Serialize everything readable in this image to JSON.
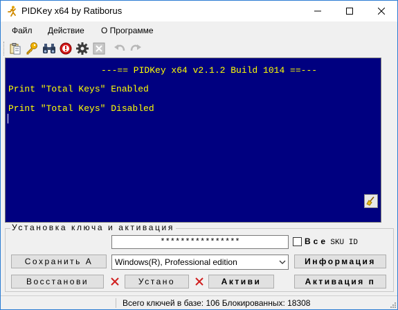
{
  "window": {
    "title": "PIDKey x64 by Ratiborus",
    "app_icon": "runner-icon",
    "controls": [
      "minimize-icon",
      "maximize-icon",
      "close-icon"
    ]
  },
  "menu": {
    "items": [
      {
        "label": "Файл"
      },
      {
        "label": "Действие"
      },
      {
        "label": "О Программе"
      }
    ]
  },
  "toolbar": {
    "icons": [
      "clipboard-icon",
      "key-icon",
      "binoculars-icon",
      "stop-icon",
      "gear-icon",
      "close-grey-icon",
      "undo-icon",
      "redo-icon"
    ]
  },
  "console": {
    "header": "---== PIDKey x64 v2.1.2 Build 1014 ==---",
    "lines": [
      "Print \"Total Keys\" Enabled",
      "Print \"Total Keys\" Disabled"
    ],
    "text_color": "#ffff00",
    "bg_color": "#000080",
    "clear_icon": "broom-icon"
  },
  "group": {
    "title": "Установка ключа и активация",
    "key_value": "****************",
    "all_sku_label_bold": "Все",
    "all_sku_label_rest": "SKU ID",
    "all_sku_checked": false,
    "buttons": {
      "save": "Сохранить А",
      "restore": "Восстанови",
      "install": "Устано",
      "activate": "Активи",
      "info": "Информация",
      "activation": "Активация п"
    },
    "edition_selected": "Windows(R), Professional edition"
  },
  "status": {
    "text": "Всего ключей в базе: 106  Блокированных: 18308"
  }
}
